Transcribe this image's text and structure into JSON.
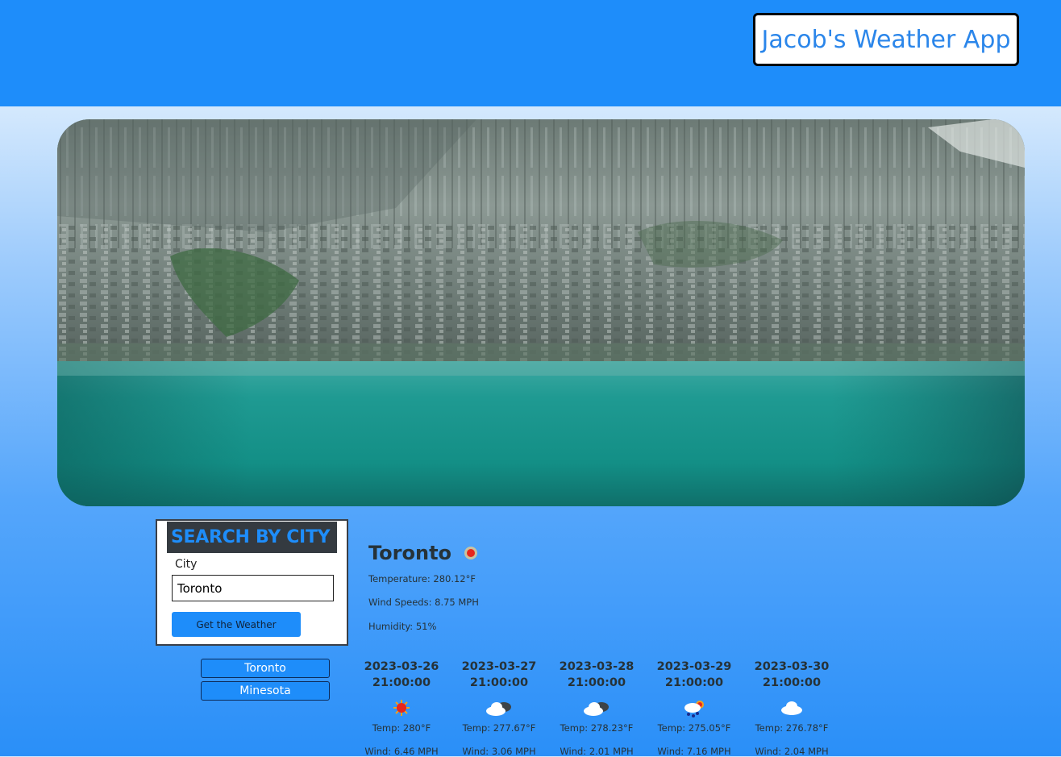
{
  "app": {
    "title": "Jacob's Weather App",
    "header_color": "#1e8dfa"
  },
  "search": {
    "heading": "SEARCH BY CITY",
    "city_label": "City",
    "city_value": "Toronto",
    "button_label": "Get the Weather"
  },
  "history": [
    "Toronto",
    "Minesota"
  ],
  "current": {
    "city": "Toronto",
    "icon": "sun-icon",
    "temperature": "Temperature: 280.12°F",
    "wind": "Wind Speeds: 8.75 MPH",
    "humidity": "Humidity: 51%"
  },
  "forecast": [
    {
      "date": "2023-03-26",
      "time": "21:00:00",
      "icon": "sun-icon",
      "temp": "Temp: 280°F",
      "wind": "Wind: 6.46 MPH"
    },
    {
      "date": "2023-03-27",
      "time": "21:00:00",
      "icon": "dark-cloud-icon",
      "temp": "Temp: 277.67°F",
      "wind": "Wind: 3.06 MPH"
    },
    {
      "date": "2023-03-28",
      "time": "21:00:00",
      "icon": "dark-cloud-icon",
      "temp": "Temp: 278.23°F",
      "wind": "Wind: 2.01 MPH"
    },
    {
      "date": "2023-03-29",
      "time": "21:00:00",
      "icon": "rain-sun-icon",
      "temp": "Temp: 275.05°F",
      "wind": "Wind: 7.16 MPH"
    },
    {
      "date": "2023-03-30",
      "time": "21:00:00",
      "icon": "cloud-icon",
      "temp": "Temp: 276.78°F",
      "wind": "Wind: 2.04 MPH"
    }
  ]
}
